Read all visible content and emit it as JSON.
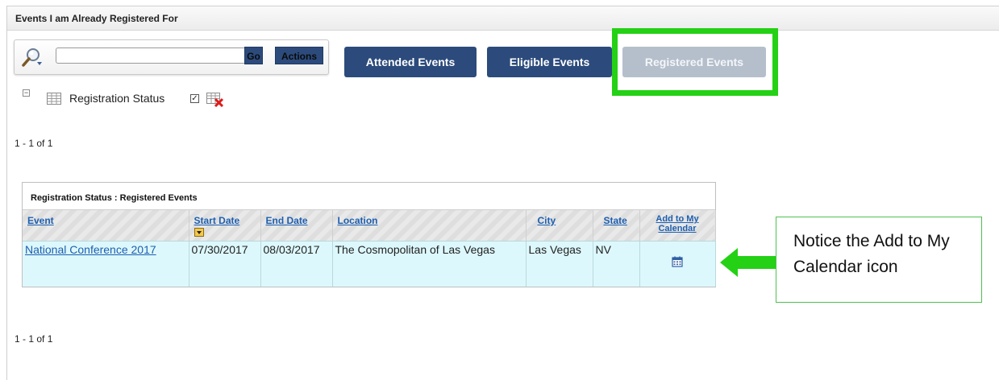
{
  "panel": {
    "title": "Events I am Already Registered For"
  },
  "search": {
    "value": "",
    "go_label": "Go",
    "actions_label": "Actions"
  },
  "tabs": [
    {
      "label": "Attended Events",
      "state": "active"
    },
    {
      "label": "Eligible Events",
      "state": "active"
    },
    {
      "label": "Registered Events",
      "state": "disabled"
    }
  ],
  "filter": {
    "label": "Registration Status",
    "checked": true
  },
  "pager": {
    "top": "1 - 1 of 1",
    "bottom": "1 - 1 of 1"
  },
  "table": {
    "caption": "Registration Status : Registered Events",
    "columns": [
      "Event",
      "Start Date",
      "End Date",
      "Location",
      "City",
      "State",
      "Add to My Calendar"
    ],
    "rows": [
      {
        "event": "National Conference 2017",
        "start_date": "07/30/2017",
        "end_date": "08/03/2017",
        "location": "The Cosmopolitan of Las Vegas",
        "city": "Las Vegas",
        "state": "NV",
        "calendar_icon": "calendar-icon"
      }
    ]
  },
  "callout": {
    "text": "Notice the Add to My Calendar icon"
  },
  "colors": {
    "nav_button": "#2c4b7c",
    "disabled_button": "#b5bfcc",
    "highlight": "#24d115",
    "row_bg": "#ddf8fc",
    "link": "#1d5fb0"
  }
}
